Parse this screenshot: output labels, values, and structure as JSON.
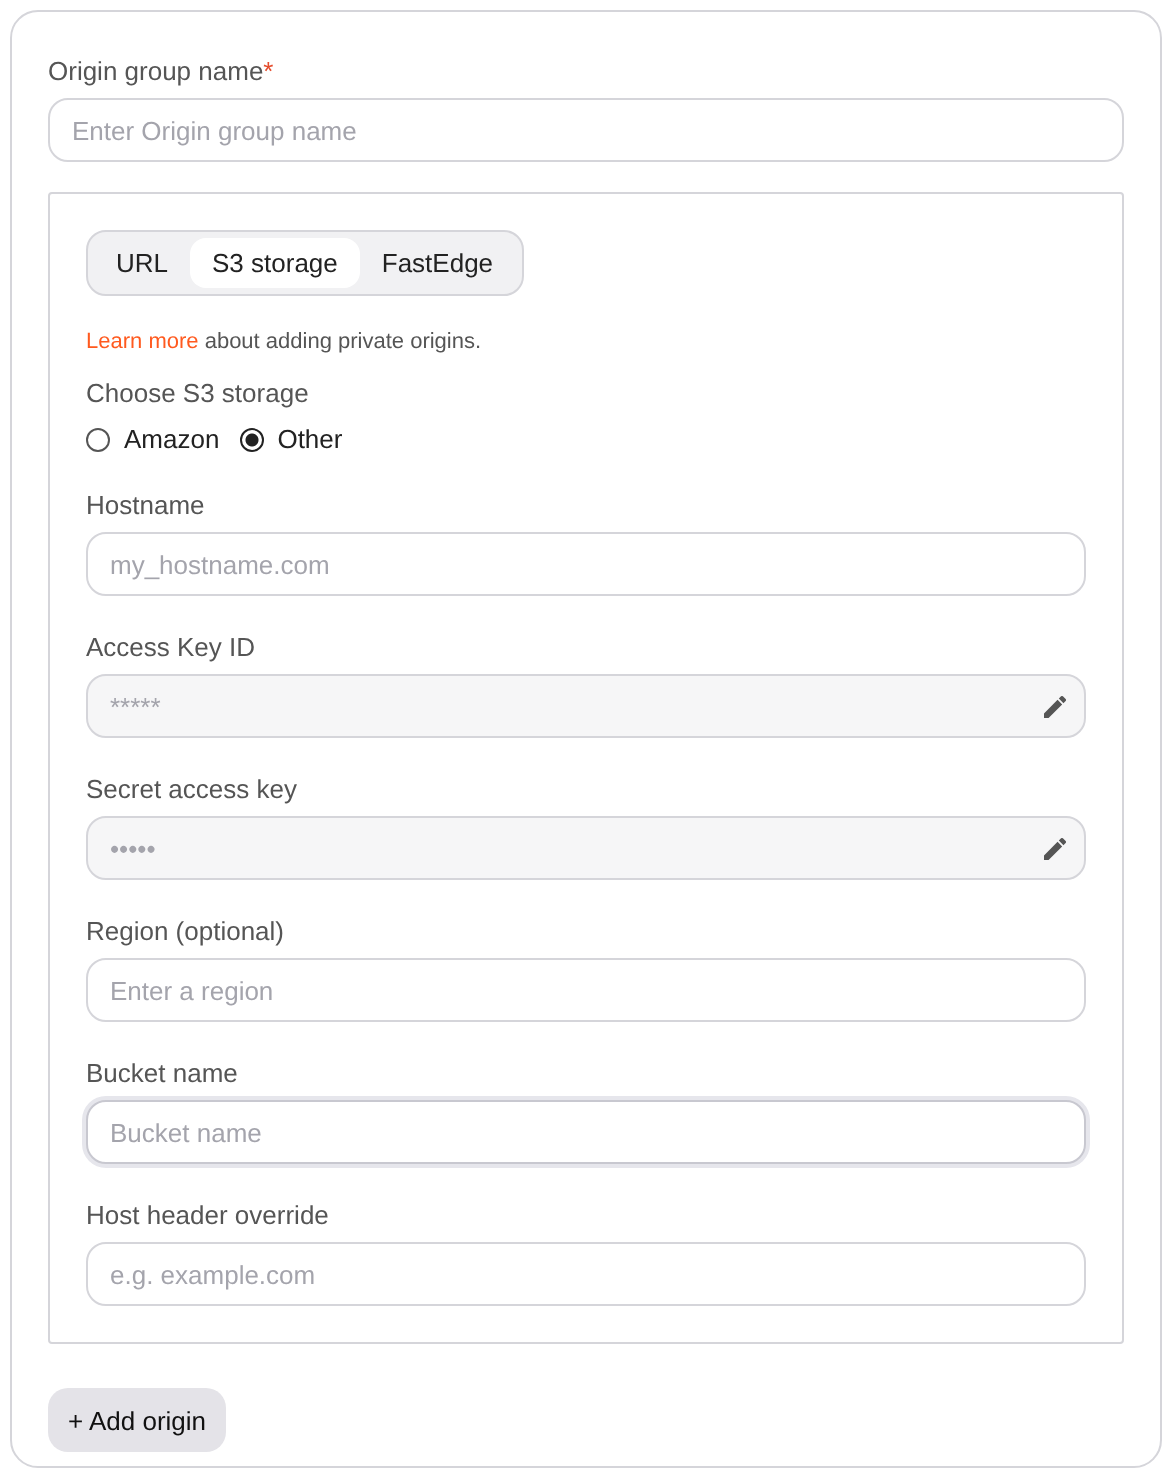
{
  "group_name": {
    "label": "Origin group name",
    "required_mark": "*",
    "placeholder": "Enter Origin group name"
  },
  "origin": {
    "tabs": [
      {
        "label": "URL",
        "selected": false
      },
      {
        "label": "S3 storage",
        "selected": true
      },
      {
        "label": "FastEdge",
        "selected": false
      }
    ],
    "note": {
      "link": "Learn more",
      "text": "about adding private origins."
    },
    "storage": {
      "label": "Choose S3 storage",
      "options": [
        {
          "label": "Amazon",
          "selected": false
        },
        {
          "label": "Other",
          "selected": true
        }
      ]
    },
    "fields": [
      {
        "label": "Hostname",
        "placeholder": "my_hostname.com",
        "disabled": false,
        "focused": false
      },
      {
        "label": "Access Key ID",
        "placeholder": "*****",
        "disabled": true,
        "focused": false
      },
      {
        "label": "Secret access key",
        "placeholder": "•••••",
        "disabled": true,
        "focused": false
      },
      {
        "label": "Region (optional)",
        "placeholder": "Enter a region",
        "disabled": false,
        "focused": false
      },
      {
        "label": "Bucket name",
        "placeholder": "Bucket name",
        "disabled": false,
        "focused": true
      },
      {
        "label": "Host header override",
        "placeholder": "e.g. example.com",
        "disabled": false,
        "focused": false
      }
    ]
  },
  "add_button": "+ Add origin"
}
